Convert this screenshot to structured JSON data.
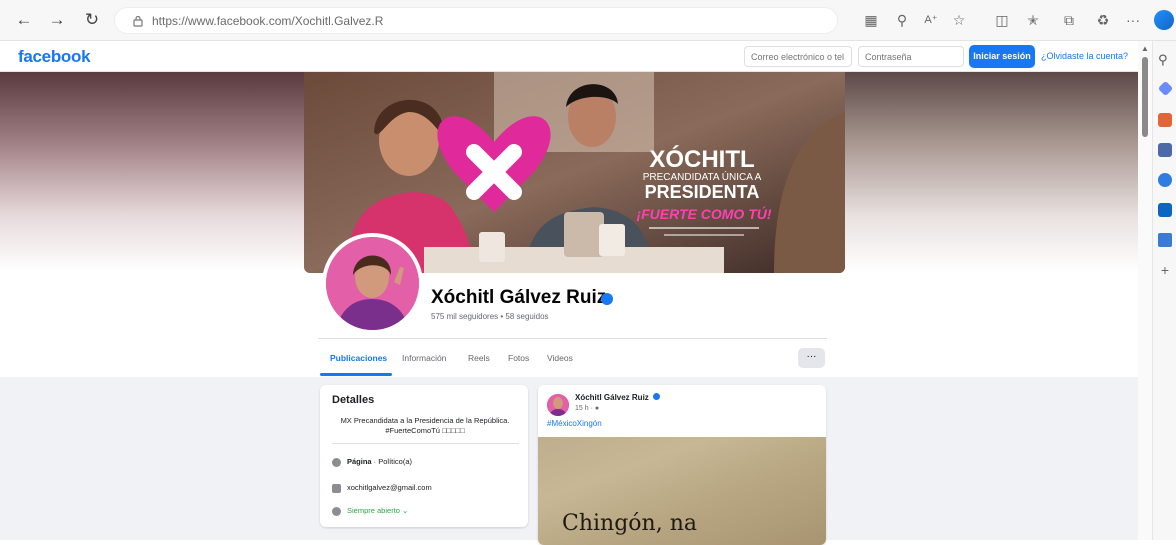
{
  "browser": {
    "url": "https://www.facebook.com/Xochitl.Galvez.R",
    "ellipsis": "···"
  },
  "header": {
    "logo": "facebook",
    "email_placeholder": "Correo electrónico o tel",
    "password_placeholder": "Contraseña",
    "login_label": "Iniciar sesión",
    "forgot_label": "¿Olvidaste la cuenta?"
  },
  "cover": {
    "brand_name": "XÓCHITL",
    "subtitle": "PRECANDIDATA ÚNICA A",
    "role": "PRESIDENTA",
    "slogan": "¡FUERTE COMO TÚ!"
  },
  "profile": {
    "name": "Xóchitl Gálvez Ruiz",
    "stats": "575 mil seguidores • 58 seguidos"
  },
  "tabs": [
    {
      "label": "Publicaciones"
    },
    {
      "label": "Información"
    },
    {
      "label": "Reels"
    },
    {
      "label": "Fotos"
    },
    {
      "label": "Videos"
    }
  ],
  "tabs_more": "···",
  "details": {
    "title": "Detalles",
    "bio": "MX Precandidata a la Presidencia de la República. #FuerteComoTú □□□□□",
    "category_label": "Página",
    "category_value": " · Político(a)",
    "email": "xochitlgalvez@gmail.com",
    "hours": "Siempre abierto",
    "hours_chevron": "⌄"
  },
  "post": {
    "author": "Xóchitl Gálvez Ruiz",
    "time": "15 h · ",
    "hashtag": "#MéxicoXingón",
    "image_text": "Chingón, na"
  },
  "colors": {
    "brand_blue": "#1877f2",
    "cover_magenta": "#e0299a",
    "open_green": "#31a24c"
  }
}
